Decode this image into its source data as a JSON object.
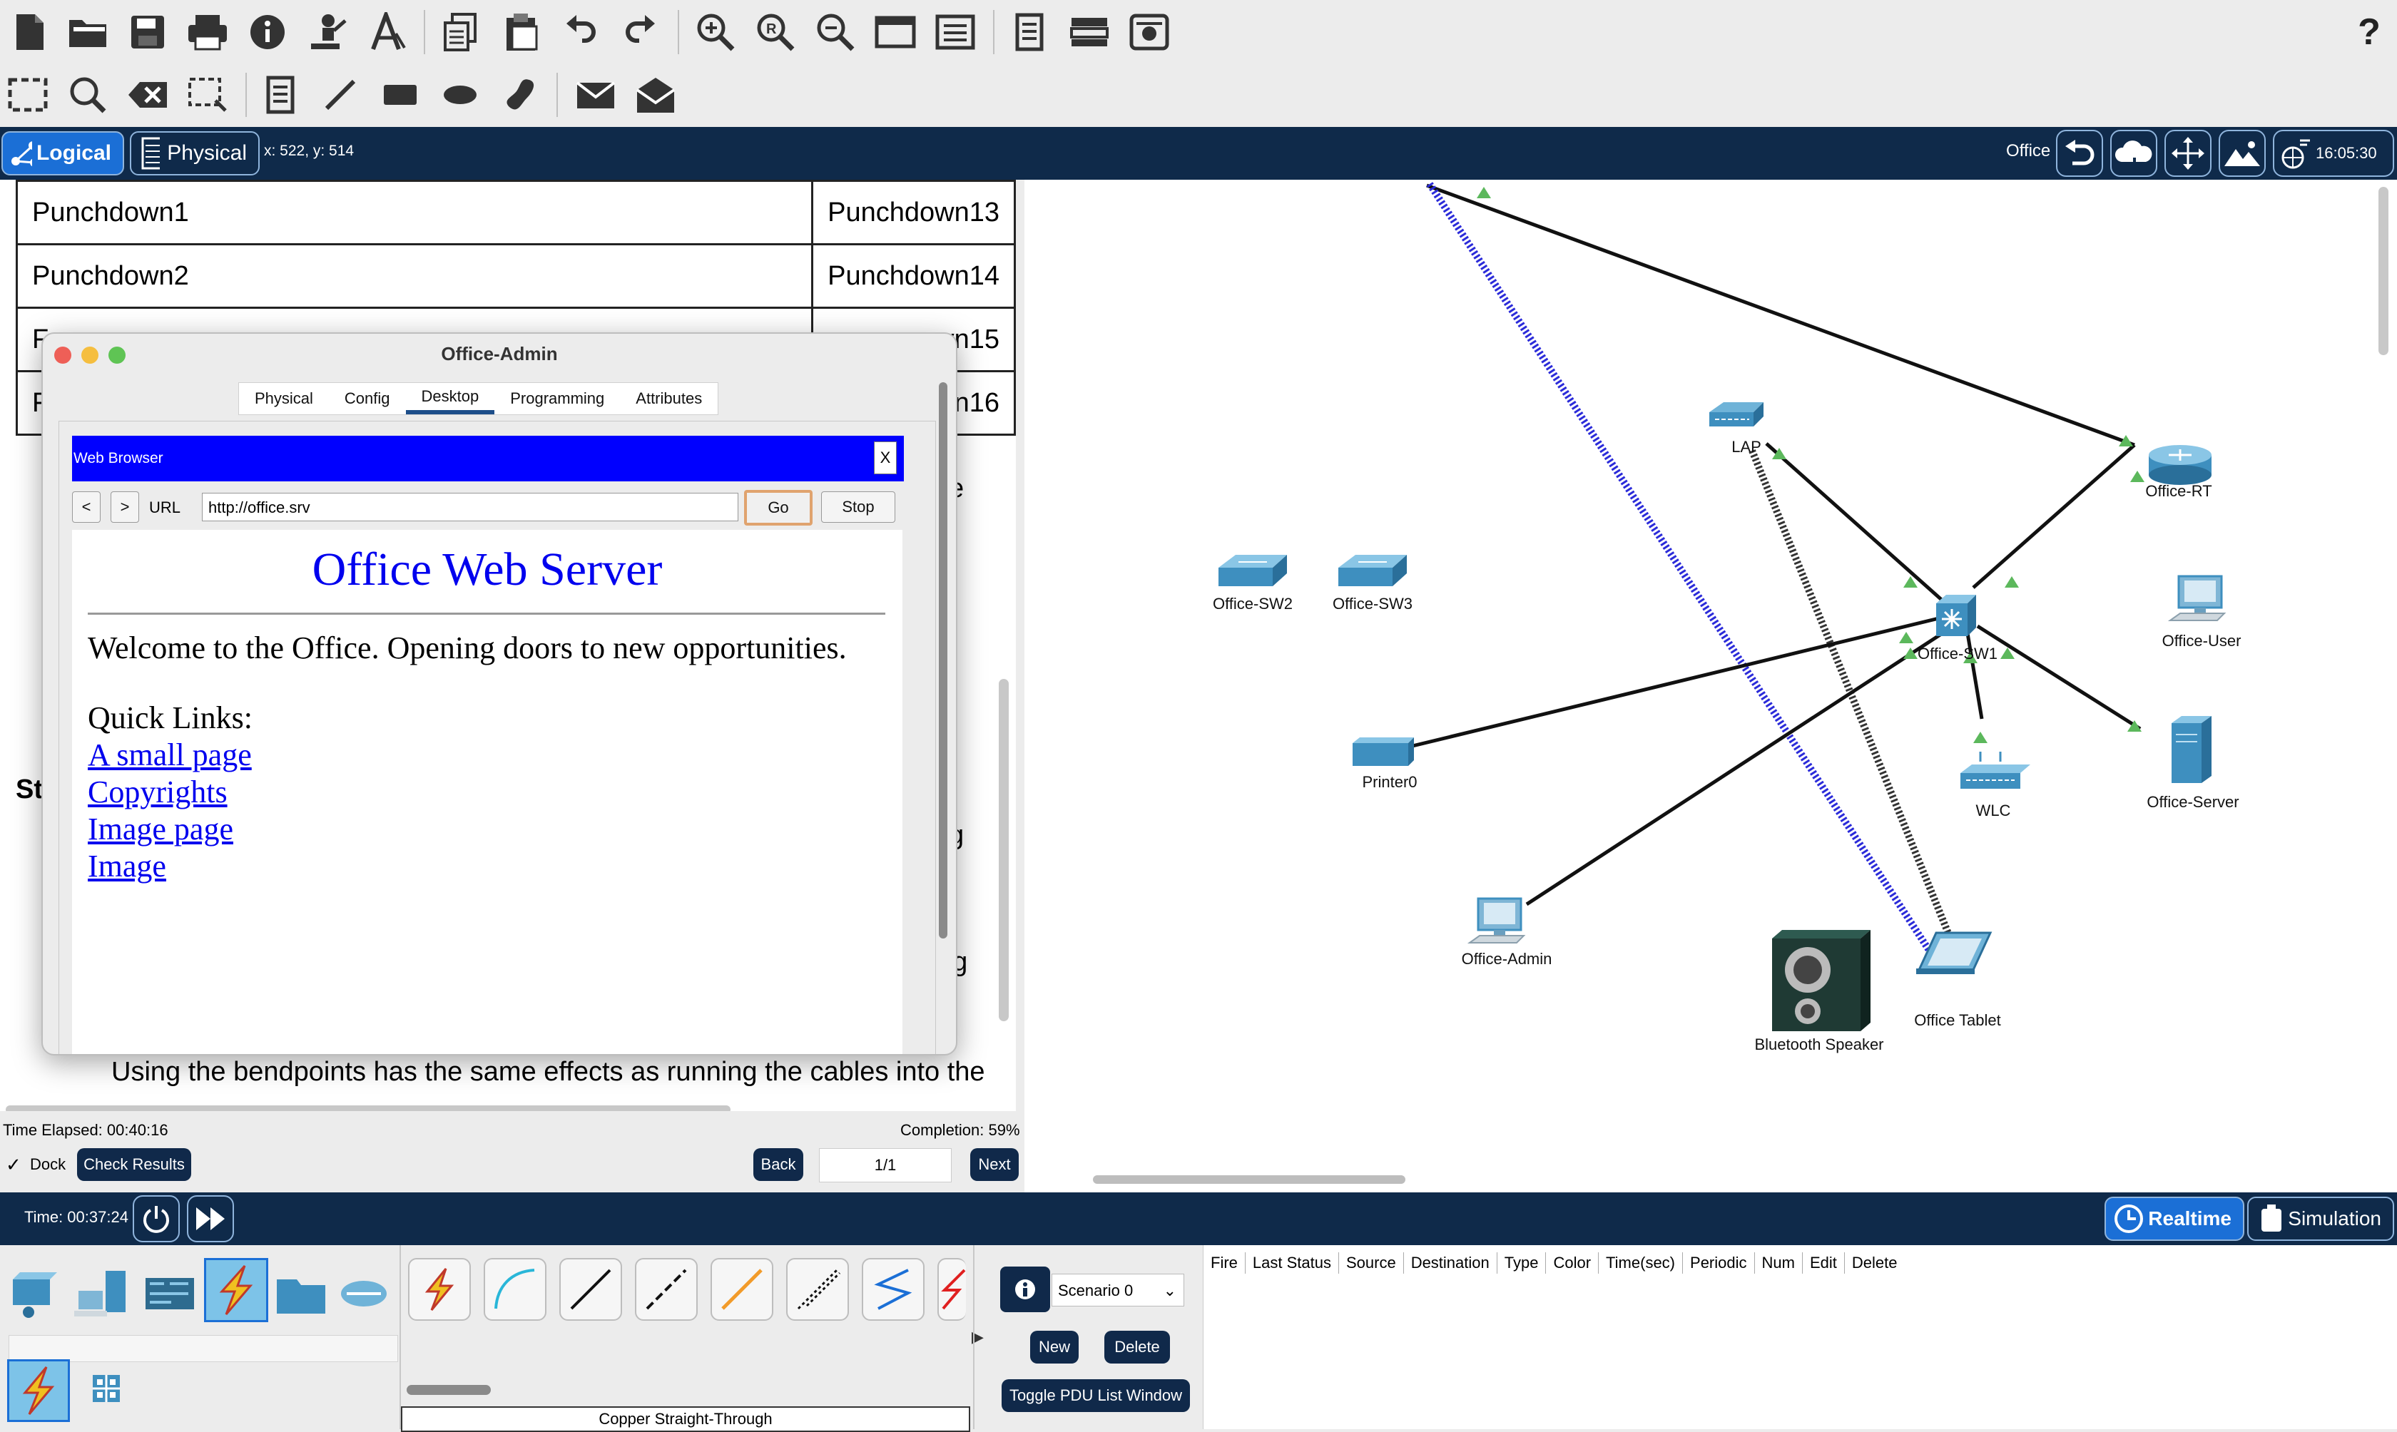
{
  "toolbar": {
    "row1_icons": [
      "new-file-icon",
      "open-folder-icon",
      "save-icon",
      "print-icon",
      "info-icon",
      "activity-wizard-icon",
      "custom-pdu-icon",
      "copy-icon",
      "paste-icon",
      "undo-icon",
      "redo-icon",
      "zoom-in-icon",
      "zoom-reset-icon",
      "zoom-out-icon",
      "drawing-palette-icon",
      "custom-device-icon",
      "notes-icon",
      "network-info-icon",
      "cluster-icon"
    ],
    "row2_icons": [
      "select-icon",
      "inspect-icon",
      "delete-icon",
      "resize-icon",
      "note-icon",
      "line-icon",
      "rectangle-icon",
      "ellipse-icon",
      "freeform-icon",
      "simple-pdu-icon",
      "complex-pdu-icon"
    ],
    "help_glyph": "?"
  },
  "nav": {
    "logical_label": "Logical",
    "physical_label": "Physical",
    "coords": "x: 522, y: 514",
    "location": "Office",
    "clock": "16:05:30"
  },
  "instructions": {
    "table": [
      [
        "Punchdown1",
        "Punchdown13"
      ],
      [
        "Punchdown2",
        "Punchdown14"
      ],
      [
        "F",
        "vn15"
      ],
      [
        "F",
        "vn16"
      ]
    ],
    "fragment_e": "e",
    "fragment_st": "St",
    "fragment_g": "g",
    "fragment_ag": "ag",
    "bottom_text": "Using the bendpoints has the same effects as running the cables into the"
  },
  "dock": {
    "time_elapsed": "Time Elapsed: 00:40:16",
    "completion": "Completion: 59%",
    "dock_label": "Dock",
    "check_results": "Check Results",
    "back": "Back",
    "page": "1/1",
    "next": "Next"
  },
  "dialog": {
    "title": "Office-Admin",
    "tabs": [
      "Physical",
      "Config",
      "Desktop",
      "Programming",
      "Attributes"
    ],
    "active_tab": "Desktop",
    "browser": {
      "title": "Web Browser",
      "close": "X",
      "back": "<",
      "forward": ">",
      "url_label": "URL",
      "url": "http://office.srv",
      "go": "Go",
      "stop": "Stop",
      "heading": "Office Web Server",
      "welcome": "Welcome to the Office. Opening doors to new opportunities.",
      "quick_links_label": "Quick Links:",
      "links": [
        "A small page",
        "Copyrights",
        "Image page",
        "Image"
      ]
    }
  },
  "topology": {
    "devices": [
      {
        "id": "lap",
        "label": "LAP"
      },
      {
        "id": "router",
        "label": "Office-RT"
      },
      {
        "id": "sw2",
        "label": "Office-SW2"
      },
      {
        "id": "sw3",
        "label": "Office-SW3"
      },
      {
        "id": "sw1",
        "label": "Office-SW1"
      },
      {
        "id": "user",
        "label": "Office-User"
      },
      {
        "id": "printer",
        "label": "Printer0"
      },
      {
        "id": "wlc",
        "label": "WLC"
      },
      {
        "id": "server",
        "label": "Office-Server"
      },
      {
        "id": "admin",
        "label": "Office-Admin"
      },
      {
        "id": "speaker",
        "label": "Bluetooth Speaker"
      },
      {
        "id": "tablet",
        "label": "Office Tablet"
      }
    ]
  },
  "bottom": {
    "time": "Time: 00:37:24",
    "realtime": "Realtime",
    "simulation": "Simulation",
    "cable_name": "Copper Straight-Through",
    "scenario": "Scenario 0",
    "new": "New",
    "delete": "Delete",
    "toggle_pdu": "Toggle PDU List Window",
    "pdu_columns": [
      "Fire",
      "Last Status",
      "Source",
      "Destination",
      "Type",
      "Color",
      "Time(sec)",
      "Periodic",
      "Num",
      "Edit",
      "Delete"
    ]
  },
  "colors": {
    "navy": "#0f2a4a",
    "accent_blue": "#1b6fd6",
    "link_green": "#5cb85c",
    "browser_blue": "#0000ff"
  }
}
